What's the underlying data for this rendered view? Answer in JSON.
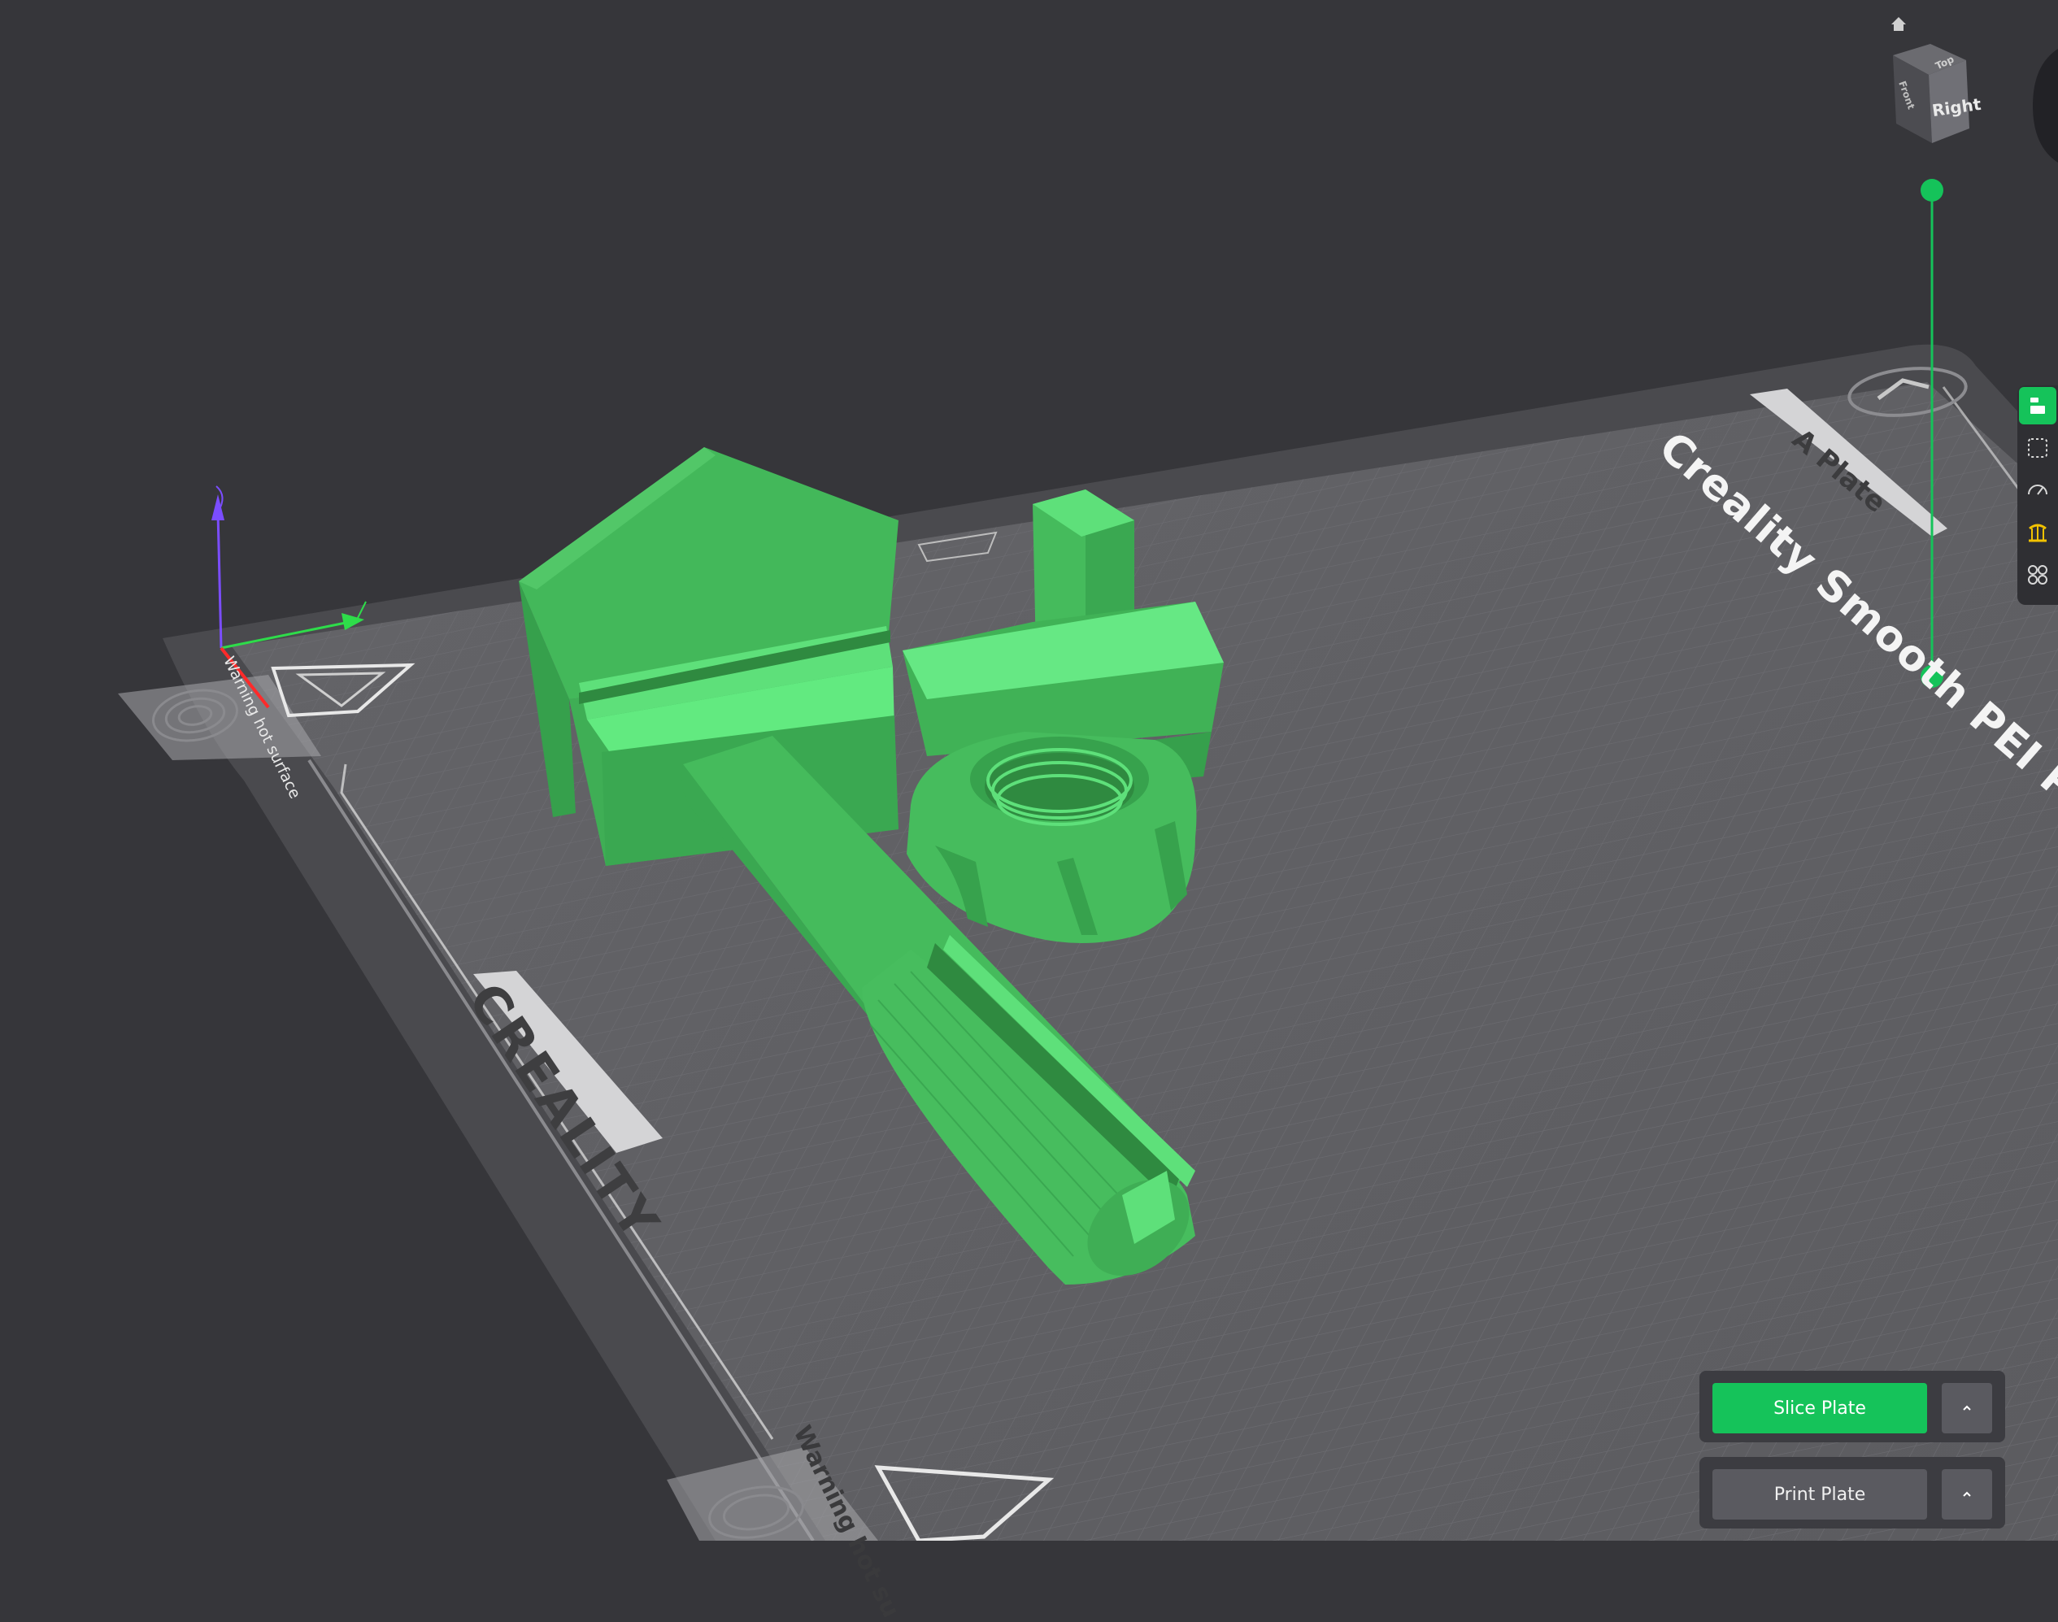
{
  "viewport": {
    "view_cube": {
      "right_label": "Right",
      "top_label": "Top",
      "front_label": "Front"
    },
    "plate_name": "Creality Smooth PEI Plate",
    "plate_tag": "A Plate",
    "brand": "CREALITY",
    "warning_text_1": "Warning hot surface",
    "warning_text_2": "Warning hot su"
  },
  "toolbar": {
    "items": [
      {
        "icon": "plate-list-icon",
        "active": true
      },
      {
        "icon": "select-area-icon",
        "active": false
      },
      {
        "icon": "speed-gauge-icon",
        "active": false
      },
      {
        "icon": "support-icon",
        "active": false
      },
      {
        "icon": "arrange-icon",
        "active": false
      }
    ]
  },
  "actions": {
    "slice_label": "Slice Plate",
    "print_label": "Print Plate"
  },
  "colors": {
    "accent": "#15c35a",
    "model": "#43b85a",
    "model_highlight": "#5ee07a",
    "background": "#36363a",
    "bed": "#606064",
    "grid": "#6c6c71"
  }
}
